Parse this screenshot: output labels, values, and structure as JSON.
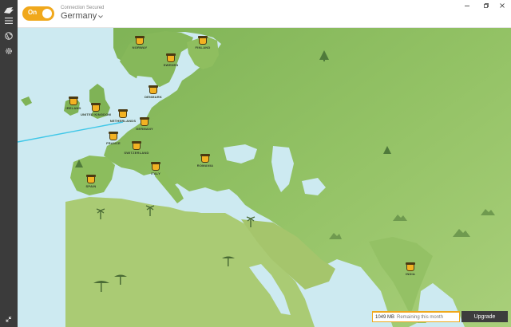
{
  "header": {
    "toggle_label": "On",
    "status": "Connection Secured",
    "location": "Germany"
  },
  "footer": {
    "data_amount": "1049 MB",
    "data_remaining": "Remaining this month",
    "upgrade_label": "Upgrade"
  },
  "countries": [
    {
      "key": "norway",
      "label": "NORWAY"
    },
    {
      "key": "finland",
      "label": "FINLAND"
    },
    {
      "key": "sweden",
      "label": "SWEDEN"
    },
    {
      "key": "denmark",
      "label": "DENMARK"
    },
    {
      "key": "ireland",
      "label": "IRELAND"
    },
    {
      "key": "uk",
      "label": "UNITED KINGDOM"
    },
    {
      "key": "netherlands",
      "label": "NETHERLANDS"
    },
    {
      "key": "germany",
      "label": "GERMANY"
    },
    {
      "key": "france",
      "label": "FRANCE"
    },
    {
      "key": "switzerland",
      "label": "SWITZERLAND"
    },
    {
      "key": "romania",
      "label": "ROMANIA"
    },
    {
      "key": "spain",
      "label": "SPAIN"
    },
    {
      "key": "italy",
      "label": "ITALY"
    },
    {
      "key": "india",
      "label": "INDIA"
    }
  ],
  "colors": {
    "accent": "#f0a81c",
    "sidebar": "#3b3b3b",
    "water": "#cdeaf1",
    "land": "#8fbf5f",
    "connection_line": "#3fc7e8"
  }
}
